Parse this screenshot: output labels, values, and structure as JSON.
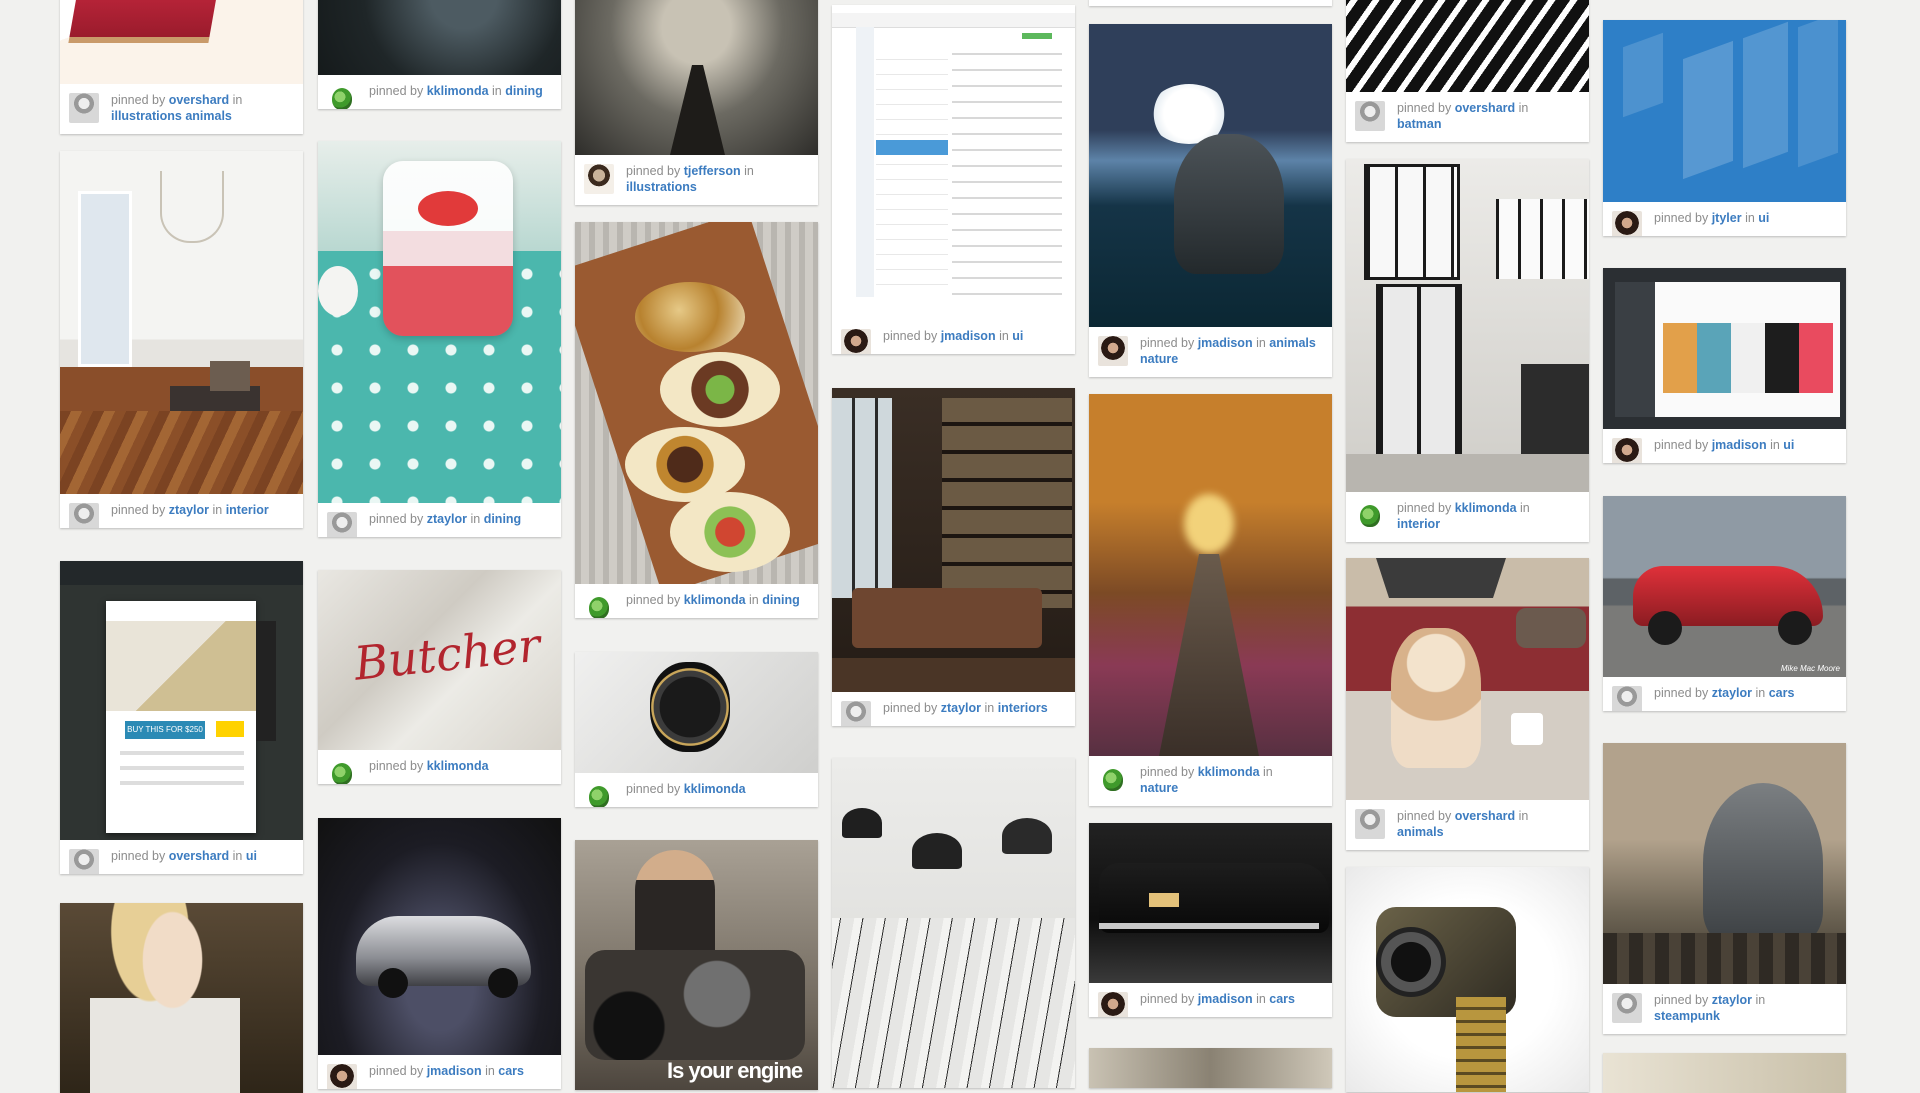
{
  "labels": {
    "pinned_by": "pinned by",
    "in": "in"
  },
  "pins": [
    {
      "user": "overshard",
      "board": "illustrations animals",
      "image": "book-icon-art"
    },
    {
      "user": "ztaylor",
      "board": "interior",
      "image": "white-living-room"
    },
    {
      "user": "overshard",
      "board": "ui",
      "image": "furniture-app-ui"
    },
    {
      "user": "",
      "board": "",
      "image": "bridal-portrait"
    },
    {
      "user": "kklimonda",
      "board": "dining",
      "image": "neon-table"
    },
    {
      "user": "ztaylor",
      "board": "dining",
      "image": "strawberry-jar"
    },
    {
      "user": "kklimonda",
      "board": "",
      "image": "butcher-logo"
    },
    {
      "user": "jmadison",
      "board": "cars",
      "image": "silver-sports-car"
    },
    {
      "user": "tjefferson",
      "board": "illustrations",
      "image": "rock-spire"
    },
    {
      "user": "kklimonda",
      "board": "dining",
      "image": "tacos"
    },
    {
      "user": "kklimonda",
      "board": "",
      "image": "headphones"
    },
    {
      "user": "",
      "board": "",
      "image": "motorcycle-ad",
      "caption": "Is your engine"
    },
    {
      "user": "jmadison",
      "board": "ui",
      "image": "email-app-ui"
    },
    {
      "user": "ztaylor",
      "board": "interiors",
      "image": "library-room"
    },
    {
      "user": "",
      "board": "",
      "image": "lamps-and-ink"
    },
    {
      "user": "jmadison",
      "board": "animals nature",
      "image": "elephant-sea"
    },
    {
      "user": "kklimonda",
      "board": "nature",
      "image": "autumn-rails"
    },
    {
      "user": "jmadison",
      "board": "cars",
      "image": "black-classic-car"
    },
    {
      "user": "",
      "board": "",
      "image": "blurred-photo"
    },
    {
      "user": "overshard",
      "board": "batman",
      "image": "batman-comic"
    },
    {
      "user": "kklimonda",
      "board": "interior",
      "image": "loft-interior"
    },
    {
      "user": "overshard",
      "board": "animals",
      "image": "dog-coffee"
    },
    {
      "user": "",
      "board": "",
      "image": "camera-bullets"
    },
    {
      "user": "jtyler",
      "board": "ui",
      "image": "blue-mobile-ui"
    },
    {
      "user": "jmadison",
      "board": "ui",
      "image": "dark-web-ui"
    },
    {
      "user": "ztaylor",
      "board": "cars",
      "image": "red-muscle-car",
      "caption": "Mike Mac Moore"
    },
    {
      "user": "ztaylor",
      "board": "steampunk",
      "image": "steampunk-elephant"
    },
    {
      "user": "",
      "board": "",
      "image": "bottom-card"
    }
  ]
}
